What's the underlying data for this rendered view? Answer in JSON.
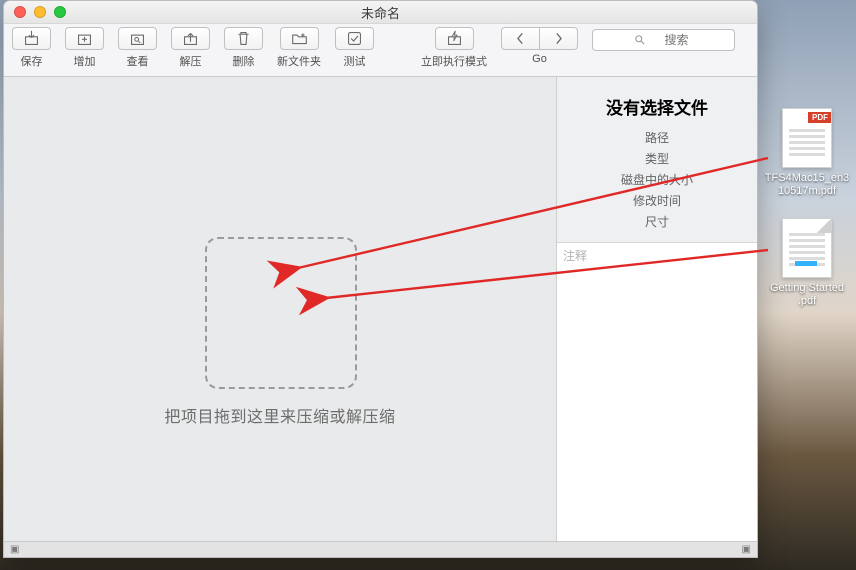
{
  "window": {
    "title": "未命名"
  },
  "toolbar": {
    "save": "保存",
    "add": "增加",
    "view": "查看",
    "extract": "解压",
    "delete": "删除",
    "newfolder": "新文件夹",
    "test": "测试",
    "runmode": "立即执行模式",
    "go": "Go",
    "search_placeholder": "搜索"
  },
  "drop": {
    "hint": "把项目拖到这里来压缩或解压缩"
  },
  "info": {
    "title": "没有选择文件",
    "rows": {
      "path": "路径",
      "type": "类型",
      "disk_size": "磁盘中的大小",
      "modified": "修改时间",
      "dim": "尺寸"
    },
    "notes_placeholder": "注释"
  },
  "desktop": {
    "files": [
      {
        "name": "TFS4Mac15_en310517m.pdf",
        "kind": "pdf"
      },
      {
        "name": "Getting Started .pdf",
        "kind": "doc"
      }
    ]
  },
  "colors": {
    "arrow": "#e02827",
    "pdf_badge": "#d5402b"
  }
}
